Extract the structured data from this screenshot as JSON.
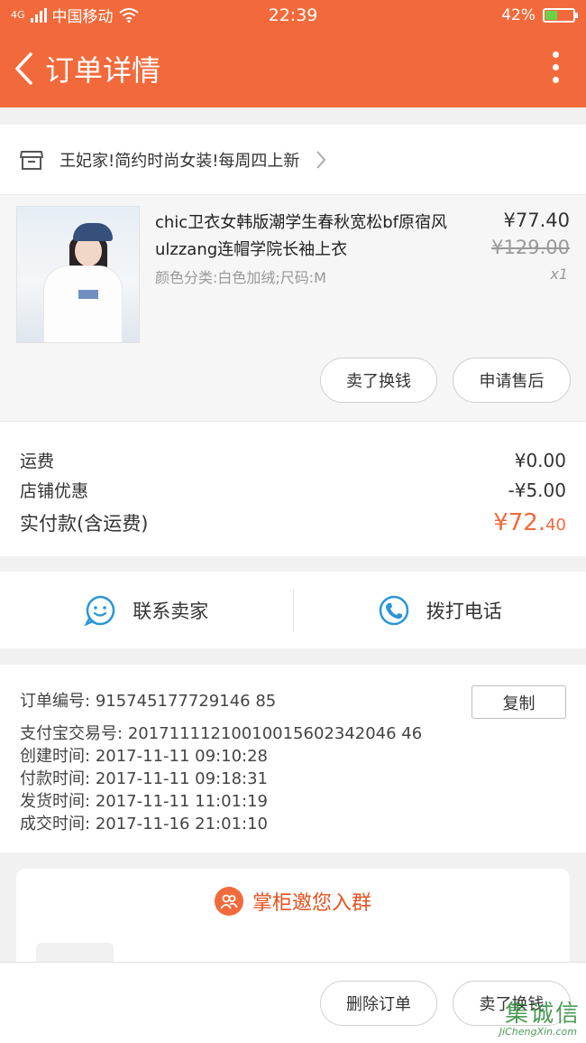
{
  "status_bar": {
    "signal": "4G",
    "carrier": "中国移动",
    "time": "22:39",
    "battery": "42%",
    "battery_level": 0.42
  },
  "header": {
    "title": "订单详情",
    "back_icon": "chevron-left-icon",
    "more_icon": "more-vertical-icon",
    "color": "#f26a3b"
  },
  "shop": {
    "name": "王妃家!简约时尚女装!每周四上新",
    "icon": "store-icon"
  },
  "product": {
    "title": "chic卫衣女韩版潮学生春秋宽松bf原宿风ulzzang连帽学院长袖上衣",
    "sku": "颜色分类:白色加绒;尺码:M",
    "price": "¥77.40",
    "original_price": "¥129.00",
    "quantity": "x1",
    "buttons": [
      "卖了换钱",
      "申请售后"
    ]
  },
  "fees": {
    "shipping_label": "运费",
    "shipping_value": "¥0.00",
    "discount_label": "店铺优惠",
    "discount_value": "-¥5.00",
    "total_label": "实付款(含运费)",
    "total_main": "¥72.",
    "total_cents": "40"
  },
  "contact": {
    "seller": "联系卖家",
    "call": "拨打电话"
  },
  "order_info": {
    "order_no_label": "订单编号:",
    "order_no": "915745177729146 85",
    "copy": "复制",
    "alipay_label": "支付宝交易号:",
    "alipay_no": "20171111210010015602342046 46",
    "created_label": "创建时间:",
    "created": "2017-11-11 09:10:28",
    "paid_label": "付款时间:",
    "paid": "2017-11-11 09:18:31",
    "shipped_label": "发货时间:",
    "shipped": "2017-11-11 11:01:19",
    "done_label": "成交时间:",
    "done": "2017-11-16 21:01:10"
  },
  "group": {
    "title": "掌柜邀您入群"
  },
  "bottom_bar": {
    "delete": "删除订单",
    "sell": "卖了换钱"
  },
  "watermark": {
    "main": "集诚信",
    "sub": "JiChengXin.com"
  }
}
